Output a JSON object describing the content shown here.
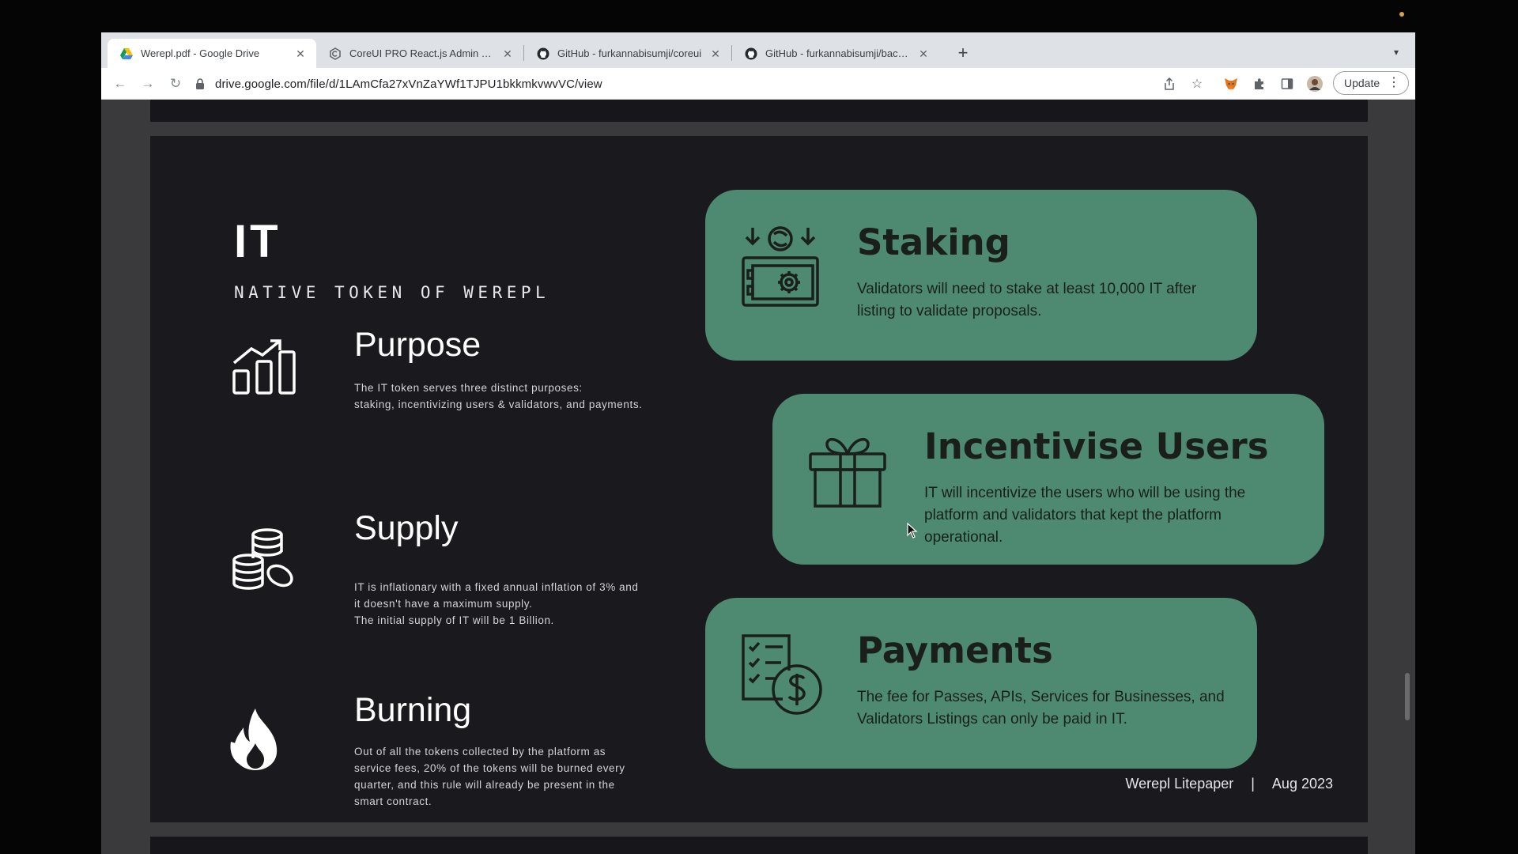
{
  "browser": {
    "tabs": [
      {
        "title": "Werepl.pdf - Google Drive",
        "icon": "google-drive-icon",
        "active": true
      },
      {
        "title": "CoreUI PRO React.js Admin Template",
        "icon": "coreui-icon",
        "active": false
      },
      {
        "title": "GitHub - furkannabisumji/coreui",
        "icon": "github-icon",
        "active": false
      },
      {
        "title": "GitHub - furkannabisumji/backend",
        "icon": "github-icon",
        "active": false
      }
    ],
    "url": "drive.google.com/file/d/1LAmCfa27xVnZaYWf1TJPU1bkkmkvwvVC/view",
    "update_label": "Update"
  },
  "page": {
    "token_title": "IT",
    "token_subtitle": "NATIVE TOKEN OF WEREPL",
    "sections": [
      {
        "heading": "Purpose",
        "text": "The IT token serves three  distinct purposes:\nstaking, incentivizing users & validators, and payments.",
        "icon": "growth-chart-icon"
      },
      {
        "heading": "Supply",
        "text": "IT is inflationary with a fixed annual inflation of 3% and\nit doesn't have a maximum supply.\nThe initial supply of IT will be 1 Billion.",
        "icon": "coin-stack-icon"
      },
      {
        "heading": "Burning",
        "text": "Out of all the tokens collected by the platform as\nservice fees, 20% of the tokens will be burned every\nquarter, and this rule will already be present in the\nsmart contract.",
        "icon": "flame-icon"
      }
    ],
    "cards": [
      {
        "title": "Staking",
        "text": "Validators will need to stake at least 10,000 IT after listing to validate proposals.",
        "icon": "vault-icon"
      },
      {
        "title": "Incentivise Users",
        "text": "IT will incentivize the users who will be using the platform and validators that kept the platform operational.",
        "icon": "gift-icon"
      },
      {
        "title": "Payments",
        "text": "The fee for Passes, APIs, Services for Businesses, and Validators Listings can only be paid in IT.",
        "icon": "checklist-dollar-icon"
      }
    ],
    "footer": {
      "doc_name": "Werepl Litepaper",
      "separator": "|",
      "date": "Aug 2023"
    }
  },
  "colors": {
    "card_green": "#4e8a72",
    "page_bg": "#1a1a1e",
    "viewer_bg": "#3a3a3c"
  }
}
